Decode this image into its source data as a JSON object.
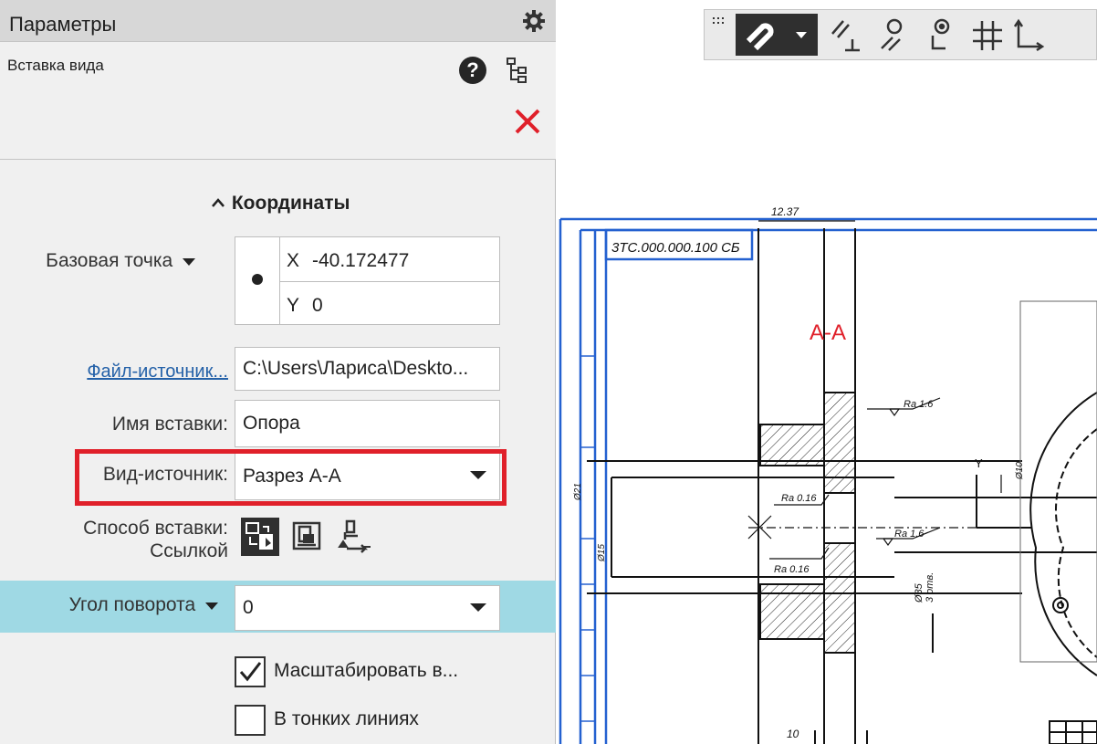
{
  "panel": {
    "title": "Параметры",
    "command_title": "Вставка вида"
  },
  "coordinates": {
    "section_title": "Координаты",
    "base_point_label": "Базовая точка",
    "x_label": "X",
    "x_value": "-40.172477",
    "y_label": "Y",
    "y_value": "0"
  },
  "source": {
    "file_link": "Файл-источник...",
    "file_value": "C:\\Users\\Лариса\\Deskto...",
    "insert_name_label": "Имя вставки:",
    "insert_name_value": "Опора",
    "view_label": "Вид-источник:",
    "view_value": "Разрез А-А"
  },
  "insert_mode": {
    "label": "Способ вставки:",
    "value": "Ссылкой"
  },
  "rotation": {
    "label": "Угол поворота",
    "value": "0"
  },
  "options": {
    "scale_label": "Масштабировать в...",
    "scale_checked": true,
    "thin_lines_label": "В тонких линиях",
    "thin_lines_checked": false
  },
  "drawing": {
    "section_label": "А-А",
    "doc_code": "3ТС.000.000.100 СБ",
    "dim_top": "12.37",
    "rough_1": "Ra 1.6",
    "rough_2": "Ra 0.16",
    "rough_3": "Ra 1.6",
    "rough_4": "Ra 0.16",
    "dim_35": "Ø35",
    "holes": "3 отв.",
    "dim_bottom": "10",
    "axis_y": "Y",
    "dim_d21": "Ø21",
    "dim_d15": "Ø15",
    "dim_d10": "Ø10"
  },
  "colors": {
    "accent_red": "#e0202a",
    "highlight_row": "#9fd9e4",
    "frame_blue": "#2461d0",
    "link_blue": "#2461a8"
  }
}
